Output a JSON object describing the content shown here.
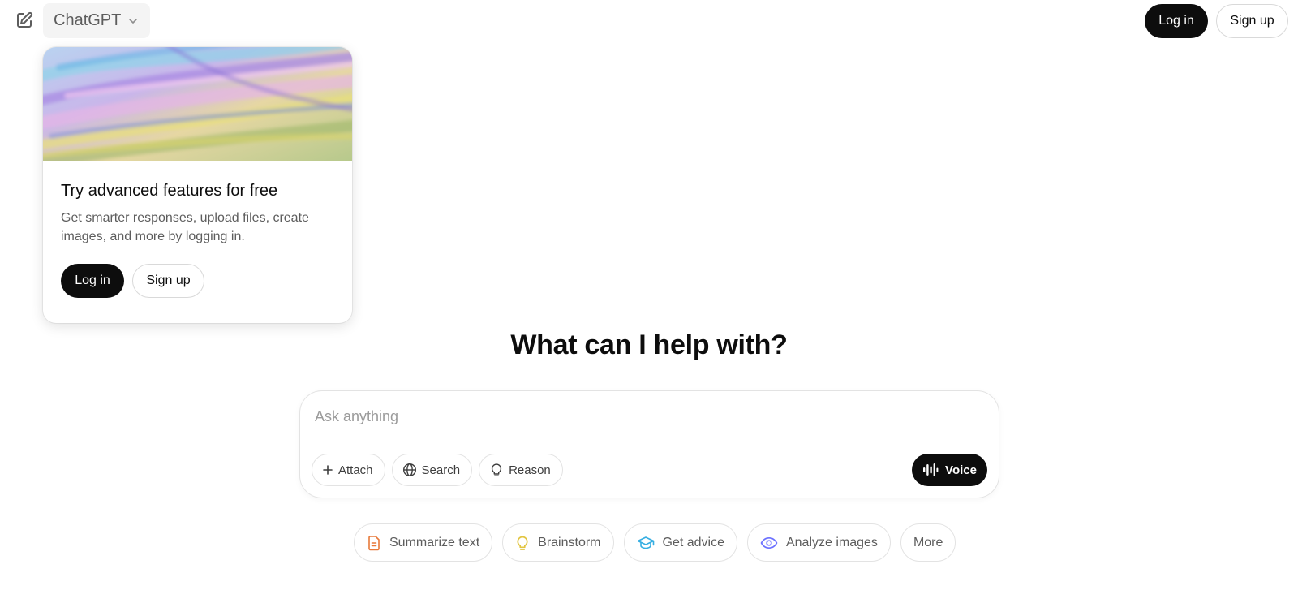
{
  "header": {
    "model_name": "ChatGPT",
    "login_label": "Log in",
    "signup_label": "Sign up",
    "icons": {
      "new_chat": "edit-icon",
      "model_dropdown": "chevron-down-icon"
    }
  },
  "promo_card": {
    "title": "Try advanced features for free",
    "description": "Get smarter responses, upload files, create images, and more by logging in.",
    "login_label": "Log in",
    "signup_label": "Sign up",
    "image": "pastel-abstract-painting"
  },
  "main": {
    "headline": "What can I help with?"
  },
  "composer": {
    "placeholder": "Ask anything",
    "value": "",
    "tools": [
      {
        "label": "Attach",
        "icon": "plus-icon"
      },
      {
        "label": "Search",
        "icon": "globe-icon"
      },
      {
        "label": "Reason",
        "icon": "lightbulb-icon"
      }
    ],
    "voice_label": "Voice",
    "voice_icon": "waveform-icon"
  },
  "suggestions": [
    {
      "label": "Summarize text",
      "icon": "document-icon",
      "color": "#e8793a"
    },
    {
      "label": "Brainstorm",
      "icon": "lightbulb-icon",
      "color": "#e2c541"
    },
    {
      "label": "Get advice",
      "icon": "graduation-cap-icon",
      "color": "#35aee2"
    },
    {
      "label": "Analyze images",
      "icon": "eye-icon",
      "color": "#6c71ff"
    },
    {
      "label": "More",
      "icon": "",
      "color": ""
    }
  ],
  "colors": {
    "primary_button": "#0d0d0d",
    "border": "#e3e3e3",
    "muted_text": "#5d5d5d"
  }
}
